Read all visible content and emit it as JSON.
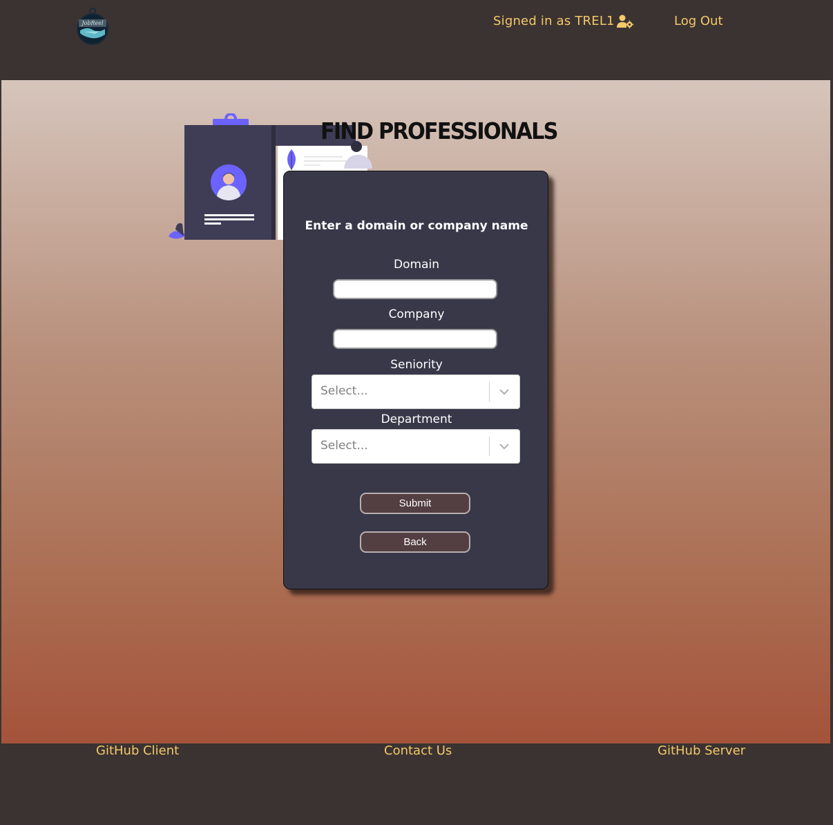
{
  "nav": {
    "logo_text": "JobReel",
    "signed_in_text": "Signed in as TREL1",
    "logout_label": "Log Out"
  },
  "main": {
    "title": "FIND PROFESSIONALS",
    "form": {
      "heading": "Enter a domain or company name",
      "domain_label": "Domain",
      "domain_value": "",
      "company_label": "Company",
      "company_value": "",
      "seniority_label": "Seniority",
      "seniority_placeholder": "Select...",
      "department_label": "Department",
      "department_placeholder": "Select...",
      "submit_label": "Submit",
      "back_label": "Back"
    }
  },
  "footer": {
    "github_client": "GitHub Client",
    "contact_us": "Contact Us",
    "github_server": "GitHub Server"
  },
  "colors": {
    "nav_background": "#3b3331",
    "link_accent": "#f4c96a",
    "card_background": "#393849",
    "button_background": "#533f42",
    "illustration_accent": "#6c63ff"
  }
}
